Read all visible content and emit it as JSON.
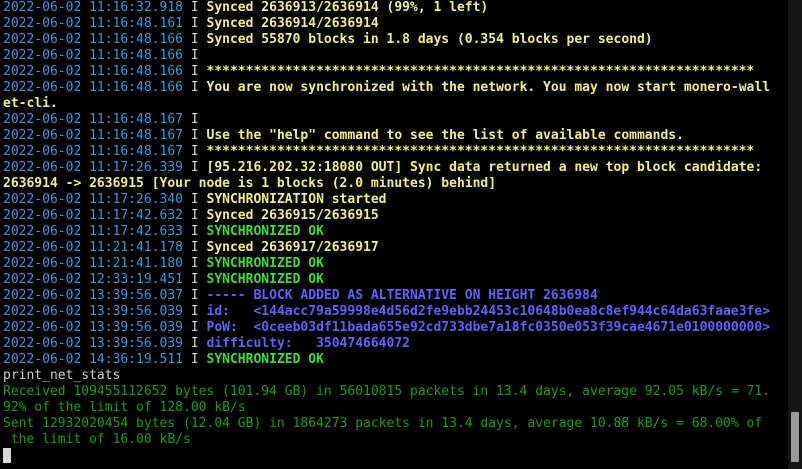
{
  "terminal": {
    "lines": [
      {
        "ts": "2022-06-02 11:16:32.918",
        "lvl": "I",
        "msg": "Synced 2636913/2636914 (99%, 1 left)",
        "cls": "y"
      },
      {
        "ts": "2022-06-02 11:16:48.161",
        "lvl": "I",
        "msg": "Synced 2636914/2636914",
        "cls": "y"
      },
      {
        "ts": "2022-06-02 11:16:48.166",
        "lvl": "I",
        "msg": "Synced 55870 blocks in 1.8 days (0.354 blocks per second)",
        "cls": "y"
      },
      {
        "ts": "2022-06-02 11:16:48.166",
        "lvl": "I",
        "msg": "",
        "cls": "y"
      },
      {
        "ts": "2022-06-02 11:16:48.166",
        "lvl": "I",
        "msg": "**********************************************************************",
        "cls": "y"
      },
      {
        "ts": "2022-06-02 11:16:48.166",
        "lvl": "I",
        "msg": "You are now synchronized with the network. You may now start monero-wall",
        "cls": "y"
      },
      {
        "cont": "et-cli.",
        "cls": "y"
      },
      {
        "ts": "2022-06-02 11:16:48.167",
        "lvl": "I",
        "msg": "",
        "cls": "y"
      },
      {
        "ts": "2022-06-02 11:16:48.167",
        "lvl": "I",
        "msg": "Use the \"help\" command to see the list of available commands.",
        "cls": "y"
      },
      {
        "ts": "2022-06-02 11:16:48.167",
        "lvl": "I",
        "msg": "**********************************************************************",
        "cls": "y"
      },
      {
        "ts": "2022-06-02 11:17:26.339",
        "lvl": "I",
        "msg": "[95.216.202.32:18080 OUT] Sync data returned a new top block candidate:",
        "cls": "y"
      },
      {
        "cont": "2636914 -> 2636915 [Your node is 1 blocks (2.0 minutes) behind]",
        "cls": "y"
      },
      {
        "ts": "2022-06-02 11:17:26.340",
        "lvl": "I",
        "msg": "SYNCHRONIZATION started",
        "cls": "y"
      },
      {
        "ts": "2022-06-02 11:17:42.632",
        "lvl": "I",
        "msg": "Synced 2636915/2636915",
        "cls": "y"
      },
      {
        "ts": "2022-06-02 11:17:42.633",
        "lvl": "I",
        "msg": "SYNCHRONIZED OK",
        "cls": "g"
      },
      {
        "ts": "2022-06-02 11:21:41.178",
        "lvl": "I",
        "msg": "Synced 2636917/2636917",
        "cls": "y"
      },
      {
        "ts": "2022-06-02 11:21:41.180",
        "lvl": "I",
        "msg": "SYNCHRONIZED OK",
        "cls": "g"
      },
      {
        "ts": "2022-06-02 12:33:19.451",
        "lvl": "I",
        "msg": "SYNCHRONIZED OK",
        "cls": "g"
      },
      {
        "ts": "2022-06-02 13:39:56.037",
        "lvl": "I",
        "msg": "----- BLOCK ADDED AS ALTERNATIVE ON HEIGHT 2636984",
        "cls": "b"
      },
      {
        "ts": "2022-06-02 13:39:56.039",
        "lvl": "I",
        "msg": "id:   <144acc79a59998e4d56d2fe9ebb24453c10648b0ea8c8ef944c64da63faae3fe>",
        "cls": "b"
      },
      {
        "ts": "2022-06-02 13:39:56.039",
        "lvl": "I",
        "msg": "PoW:  <0ceeb03df11bada655e92cd733dbe7a18fc0350e053f39cae4671e0100000000>",
        "cls": "b"
      },
      {
        "ts": "2022-06-02 13:39:56.039",
        "lvl": "I",
        "msg": "difficulty:   350474664072",
        "cls": "b"
      },
      {
        "ts": "2022-06-02 14:36:19.511",
        "lvl": "I",
        "msg": "SYNCHRONIZED OK",
        "cls": "g"
      },
      {
        "cont": "print_net_stats",
        "cls": "w"
      },
      {
        "cont": "Received 109455112652 bytes (101.94 GB) in 56010815 packets in 13.4 days, average 92.05 kB/s = 71.",
        "cls": "gn"
      },
      {
        "cont": "92% of the limit of 128.00 kB/s",
        "cls": "gn"
      },
      {
        "cont": "Sent 12932020454 bytes (12.04 GB) in 1864273 packets in 13.4 days, average 10.88 kB/s = 68.00% of",
        "cls": "gn"
      },
      {
        "cont": " the limit of 16.00 kB/s",
        "cls": "gn"
      }
    ]
  }
}
